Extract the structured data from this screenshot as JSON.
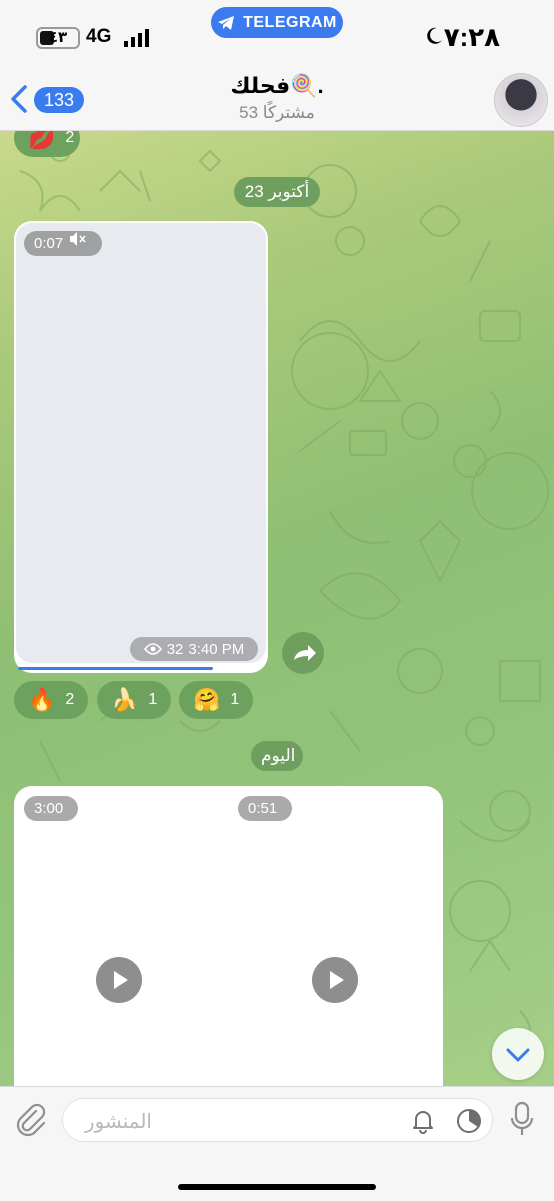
{
  "status_bar": {
    "time": "٧:٢٨",
    "network": "4G",
    "battery_label": "٤٣",
    "banner_label": "TELEGRAM",
    "icons": [
      "moon-icon",
      "signal-icon",
      "battery-icon",
      "telegram-icon"
    ]
  },
  "header": {
    "back_count": "133",
    "title": "فحلك🍭.",
    "subtitle": "53 مشتركًا",
    "icons": [
      "chevron-left-icon",
      "avatar"
    ]
  },
  "messages": {
    "top_reaction": {
      "emoji": "💋",
      "count": "2"
    },
    "date_1": "23 أكتوبر",
    "video": {
      "duration": "0:07",
      "views": "32",
      "time": "3:40 PM",
      "progress": 0.78
    },
    "reactions": [
      {
        "emoji": "🔥",
        "count": "2"
      },
      {
        "emoji": "🍌",
        "count": "1"
      },
      {
        "emoji": "🤗",
        "count": "1"
      }
    ],
    "date_2": "اليوم",
    "album": [
      {
        "duration": "3:00"
      },
      {
        "duration": "0:51"
      }
    ]
  },
  "input_bar": {
    "placeholder": "المنشور",
    "icons": [
      "paperclip-icon",
      "bell-icon",
      "timer-icon",
      "microphone-icon"
    ]
  },
  "colors": {
    "accent": "#3b7bf0",
    "bubble_bg": "#6e9f5e",
    "chat_bg_top": "#c9d98a",
    "chat_bg_bottom": "#93c47c"
  }
}
